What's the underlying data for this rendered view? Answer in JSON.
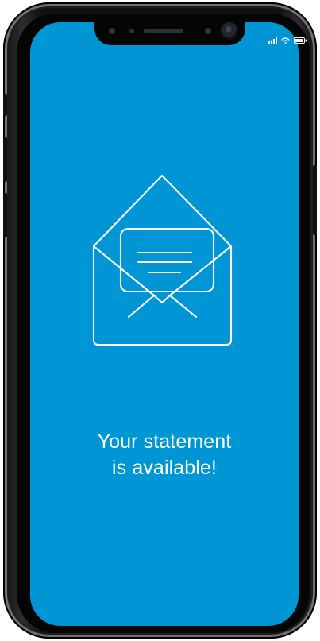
{
  "statement": {
    "headline_line_1": "Your statement",
    "headline_line_2": "is available!"
  },
  "status_bar": {
    "icons": [
      "signal-icon",
      "wifi-icon",
      "battery-icon"
    ]
  },
  "illustration": {
    "icon": "open-envelope-icon"
  },
  "colors": {
    "screen_background": "#0096d6",
    "foreground": "#ffffff",
    "device_frame": "#111111"
  }
}
